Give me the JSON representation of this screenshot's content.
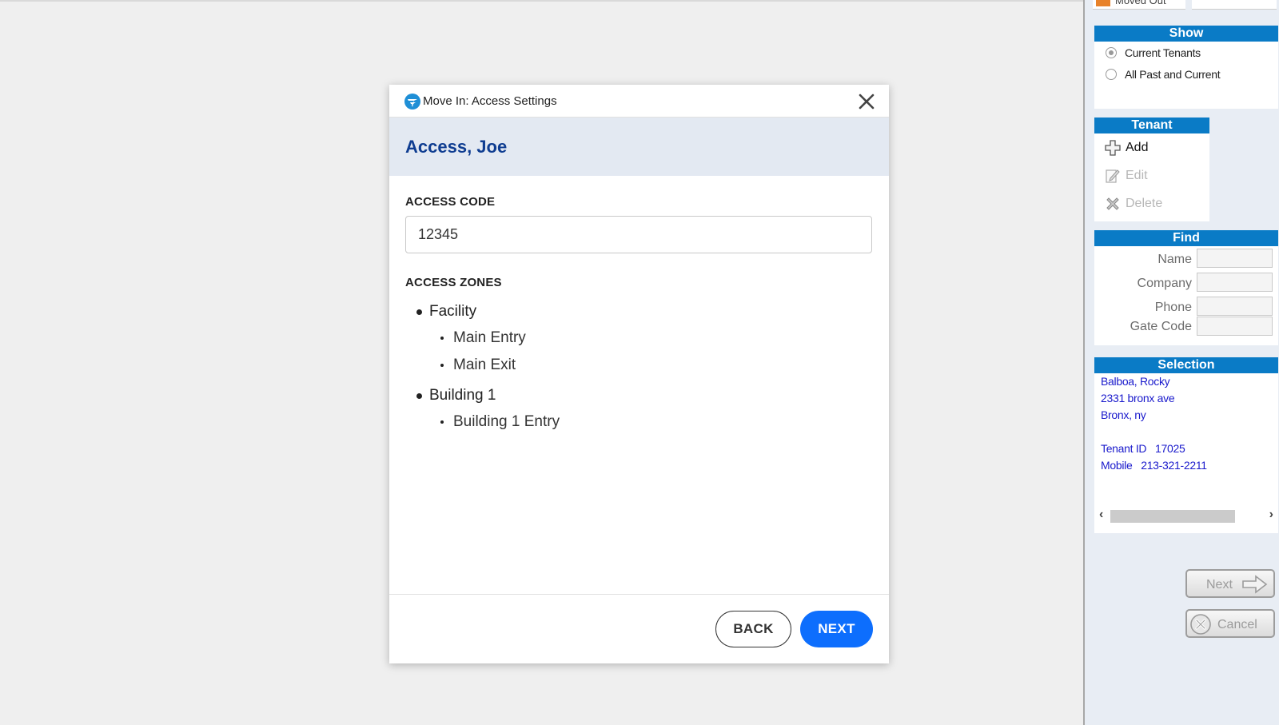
{
  "modal": {
    "title": "Move In: Access Settings",
    "tenant_name": "Access, Joe",
    "access_code_label": "ACCESS CODE",
    "access_code_value": "12345",
    "access_zones_label": "ACCESS ZONES",
    "zones": [
      {
        "name": "Facility",
        "doors": [
          "Main Entry",
          "Main Exit"
        ]
      },
      {
        "name": "Building 1",
        "doors": [
          "Building 1 Entry"
        ]
      }
    ],
    "back_label": "BACK",
    "next_label": "NEXT"
  },
  "side_panel": {
    "top_tab_text": "Moved Out",
    "show": {
      "header": "Show",
      "options": [
        {
          "label": "Current Tenants",
          "selected": true
        },
        {
          "label": "All Past and Current",
          "selected": false
        }
      ]
    },
    "tenant": {
      "header": "Tenant",
      "add_label": "Add",
      "edit_label": "Edit",
      "delete_label": "Delete"
    },
    "find": {
      "header": "Find",
      "name_label": "Name",
      "company_label": "Company",
      "phone_label": "Phone",
      "gate_code_label": "Gate Code"
    },
    "selection": {
      "header": "Selection",
      "name": "Balboa, Rocky",
      "address_line1": "2331 bronx ave",
      "address_line2": "Bronx, ny",
      "tenant_id": "Tenant ID   17025",
      "mobile": "Mobile   213-321-2211"
    },
    "next_label": "Next",
    "cancel_label": "Cancel"
  },
  "colors": {
    "primary_blue": "#0d6efd",
    "heading_blue": "#0f3d91",
    "panel_header_blue": "#0a7bc6",
    "selection_text": "#1a1acc"
  }
}
